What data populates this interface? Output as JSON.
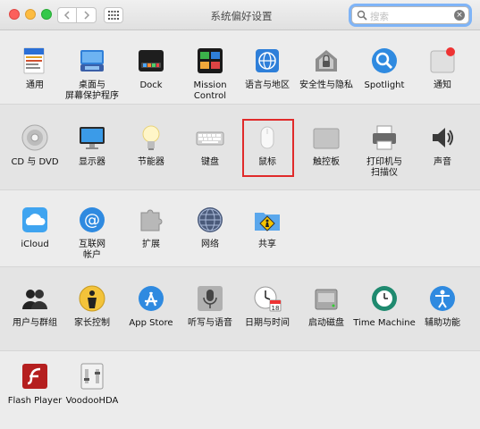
{
  "window": {
    "title": "系统偏好设置"
  },
  "search": {
    "placeholder": "搜索"
  },
  "rows": [
    [
      "通用",
      "桌面与\n屏幕保护程序",
      "Dock",
      "Mission\nControl",
      "语言与地区",
      "安全性与隐私",
      "Spotlight",
      "通知"
    ],
    [
      "CD 与 DVD",
      "显示器",
      "节能器",
      "键盘",
      "鼠标",
      "触控板",
      "打印机与\n扫描仪",
      "声音"
    ],
    [
      "iCloud",
      "互联网\n帐户",
      "扩展",
      "网络",
      "共享"
    ],
    [
      "用户与群组",
      "家长控制",
      "App Store",
      "听写与语音",
      "日期与时间",
      "启动磁盘",
      "Time Machine",
      "辅助功能"
    ],
    [
      "Flash Player",
      "VoodooHDA"
    ]
  ],
  "icons": [
    [
      "general-icon",
      "desktop-screensaver-icon",
      "dock-icon",
      "mission-control-icon",
      "language-region-icon",
      "security-privacy-icon",
      "spotlight-icon",
      "notifications-icon"
    ],
    [
      "cd-dvd-icon",
      "displays-icon",
      "energy-saver-icon",
      "keyboard-icon",
      "mouse-icon",
      "trackpad-icon",
      "printer-scanner-icon",
      "sound-icon"
    ],
    [
      "icloud-icon",
      "internet-accounts-icon",
      "extensions-icon",
      "network-icon",
      "sharing-icon"
    ],
    [
      "users-groups-icon",
      "parental-controls-icon",
      "app-store-icon",
      "dictation-speech-icon",
      "date-time-icon",
      "startup-disk-icon",
      "time-machine-icon",
      "accessibility-icon"
    ],
    [
      "flash-player-icon",
      "voodoohda-icon"
    ]
  ],
  "names": [
    [
      "general",
      "desktop-screensaver",
      "dock",
      "mission-control",
      "language-region",
      "security-privacy",
      "spotlight",
      "notifications"
    ],
    [
      "cd-dvd",
      "displays",
      "energy-saver",
      "keyboard",
      "mouse",
      "trackpad",
      "printers-scanners",
      "sound"
    ],
    [
      "icloud",
      "internet-accounts",
      "extensions",
      "network",
      "sharing"
    ],
    [
      "users-groups",
      "parental-controls",
      "app-store",
      "dictation-speech",
      "date-time",
      "startup-disk",
      "time-machine",
      "accessibility"
    ],
    [
      "flash-player",
      "voodoohda"
    ]
  ],
  "highlighted": "鼠标",
  "colors": {
    "highlight": "#e02a2a",
    "search_focus": "#7fb4f7"
  }
}
